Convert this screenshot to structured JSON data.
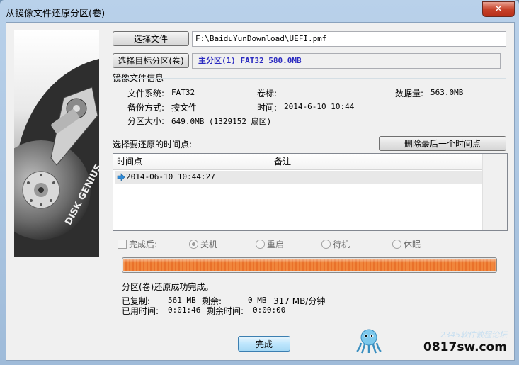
{
  "window": {
    "title": "从镜像文件还原分区(卷)",
    "close_label": "✕"
  },
  "art": {
    "brand": "DISK GENIUS"
  },
  "select_file": {
    "button": "选择文件",
    "path": "F:\\BaiduYunDownload\\UEFI.pmf"
  },
  "select_target": {
    "button": "选择目标分区(卷)",
    "value": "主分区(1) FAT32 580.0MB"
  },
  "image_info": {
    "group_label": "镜像文件信息",
    "fs_label": "文件系统:",
    "fs_value": "FAT32",
    "volume_label_label": "卷标:",
    "volume_label_value": "",
    "data_size_label": "数据量:",
    "data_size_value": "563.0MB",
    "backup_mode_label": "备份方式:",
    "backup_mode_value": "按文件",
    "time_label": "时间:",
    "time_value": "2014-6-10 10:44",
    "partition_size_label": "分区大小:",
    "partition_size_value": "649.0MB  (1329152 扇区)"
  },
  "restore_point": {
    "label": "选择要还原的时间点:",
    "delete_button": "删除最后一个时间点",
    "columns": [
      "时间点",
      "备注"
    ],
    "rows": [
      {
        "time": "2014-06-10 10:44:27",
        "note": ""
      }
    ]
  },
  "after": {
    "checkbox_label": "完成后:",
    "options": [
      "关机",
      "重启",
      "待机",
      "休眠"
    ],
    "selected": "关机"
  },
  "progress": {
    "percent": 100
  },
  "status": {
    "message": "分区(卷)还原成功完成。",
    "copied_label": "已复制:",
    "copied_value": "561 MB",
    "remaining_label": "剩余:",
    "remaining_value": "0 MB",
    "speed": "317 MB/分钟",
    "elapsed_label": "已用时间:",
    "elapsed_value": "0:01:46",
    "remaining_time_label": "剩余时间:",
    "remaining_time_value": "0:00:00"
  },
  "finish_button": "完成",
  "watermark": {
    "site": "0817sw.com",
    "forum": "2345软件教程论坛"
  },
  "colors": {
    "progress": "#ee7b33",
    "target_value": "#2a2ac0"
  }
}
